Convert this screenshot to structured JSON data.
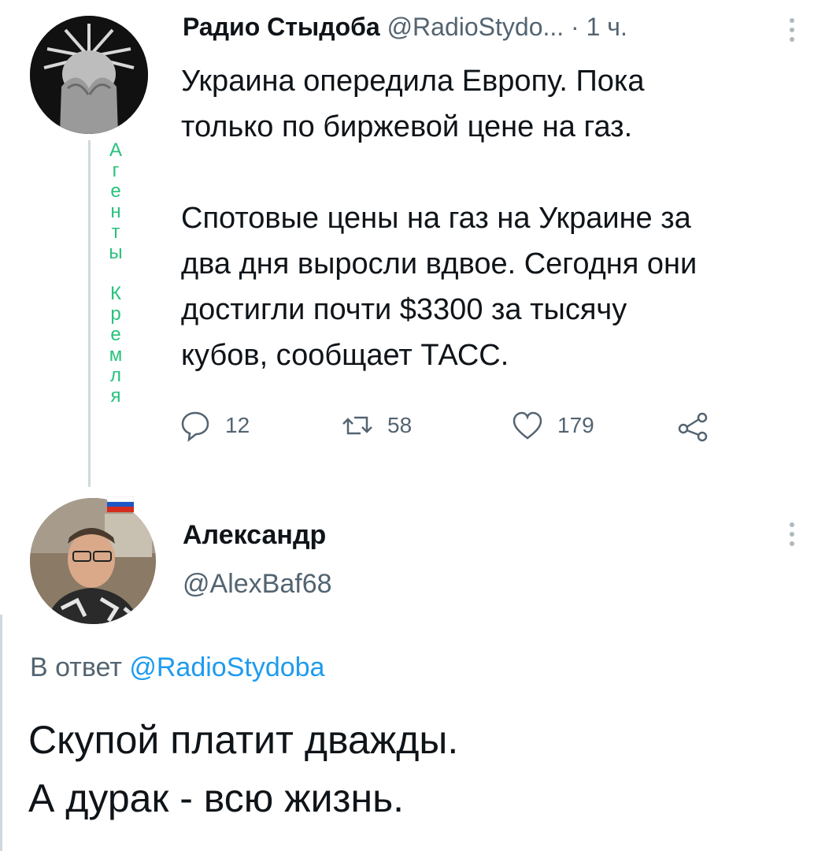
{
  "tweet1": {
    "display_name": "Радио Стыдоба",
    "handle": "@RadioStydo...",
    "time": "· 1 ч.",
    "text": "Украина опередила Европу. Пока\nтолько по биржевой цене на газ.\n\nСпотовые цены на газ на Украине за\nдва дня выросли вдвое. Сегодня они\nдостигли почти $3300 за тысячу\nкубов, сообщает ТАСС.",
    "avatar_icon": "statue-of-liberty-facepalm-avatar",
    "actions": {
      "replies": "12",
      "retweets": "58",
      "likes": "179",
      "share_icon": "share-icon"
    }
  },
  "side_annotation": "А\nг\nе\nн\nт\nы\n\nК\nр\nе\nм\nл\nя",
  "tweet2": {
    "display_name": "Александр",
    "handle": "@AlexBaf68",
    "reply_prefix": "В ответ",
    "reply_to": "@RadioStydoba",
    "text": "Скупой платит дважды.\nА дурак - всю жизнь.",
    "flag_icon": "russian-flag-icon"
  },
  "colors": {
    "accent": "#1d9bf0",
    "annotation": "#27c27c",
    "muted": "#536471",
    "text": "#0f1419"
  }
}
